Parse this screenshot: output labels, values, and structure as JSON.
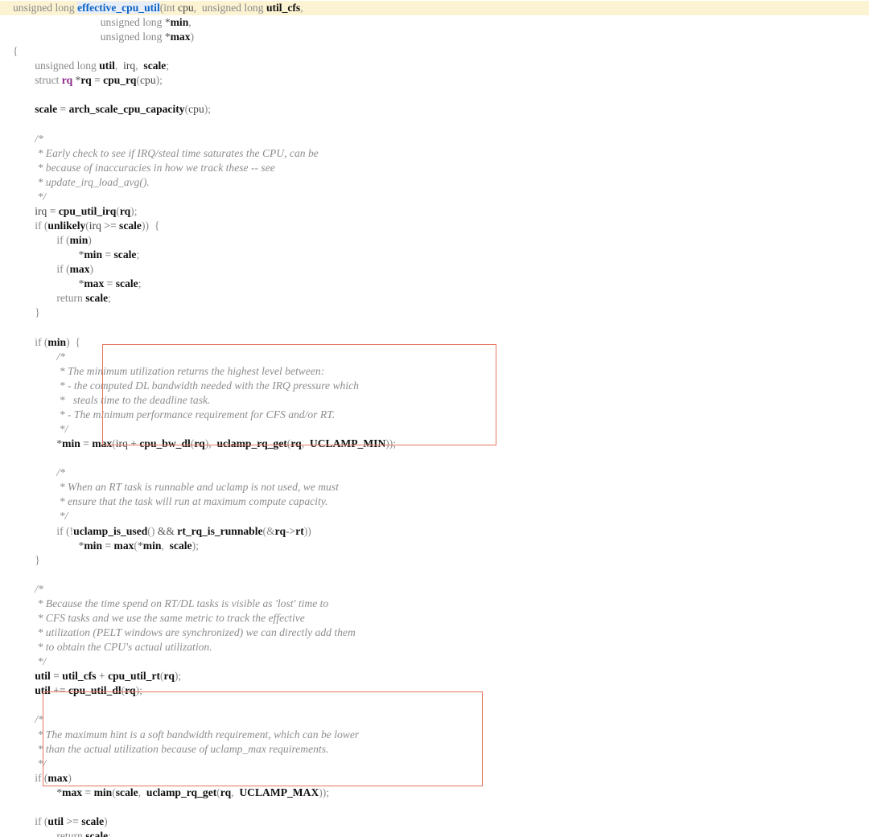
{
  "colors": {
    "current_line_bg": "#fcf3d3",
    "highlight_box": "#e4765f",
    "function_name": "#0c64c6",
    "keyword": "#888888",
    "comment": "#8d8d8d",
    "struct_keyword": "#8c2a8c"
  },
  "code": {
    "lines": [
      [
        [
          "kw",
          "unsigned long "
        ],
        [
          "fnsel",
          "effective_cpu_util"
        ],
        [
          "pn",
          "("
        ],
        [
          "kw",
          "int "
        ],
        [
          "id",
          "cpu"
        ],
        [
          "pn",
          ",  "
        ],
        [
          "kw",
          "unsigned long "
        ],
        [
          "var",
          "util_cfs"
        ],
        [
          "pn",
          ","
        ]
      ],
      [
        [
          "kw",
          "                                unsigned long "
        ],
        [
          "op",
          "*"
        ],
        [
          "var",
          "min"
        ],
        [
          "pn",
          ","
        ]
      ],
      [
        [
          "kw",
          "                                unsigned long "
        ],
        [
          "op",
          "*"
        ],
        [
          "var",
          "max"
        ],
        [
          "pn",
          ")"
        ]
      ],
      [
        [
          "pn",
          "{"
        ]
      ],
      [
        [
          "kw",
          "        unsigned long "
        ],
        [
          "var",
          "util"
        ],
        [
          "pn",
          ",  "
        ],
        [
          "id",
          "irq"
        ],
        [
          "pn",
          ",  "
        ],
        [
          "var",
          "scale"
        ],
        [
          "pn",
          ";"
        ]
      ],
      [
        [
          "kw",
          "        struct "
        ],
        [
          "ty",
          "rq "
        ],
        [
          "op",
          "*"
        ],
        [
          "var",
          "rq"
        ],
        [
          "op",
          " = "
        ],
        [
          "fn",
          "cpu_rq"
        ],
        [
          "pn",
          "("
        ],
        [
          "id",
          "cpu"
        ],
        [
          "pn",
          ");"
        ]
      ],
      [],
      [
        [
          "var",
          "        scale"
        ],
        [
          "op",
          " = "
        ],
        [
          "fn",
          "arch_scale_cpu_capacity"
        ],
        [
          "pn",
          "("
        ],
        [
          "id",
          "cpu"
        ],
        [
          "pn",
          ");"
        ]
      ],
      [],
      [
        [
          "cm",
          "        /*"
        ]
      ],
      [
        [
          "cm",
          "         * Early check to see if IRQ/steal time saturates the CPU, can be"
        ]
      ],
      [
        [
          "cm",
          "         * because of inaccuracies in how we track these -- see"
        ]
      ],
      [
        [
          "cm",
          "         * update_irq_load_avg()."
        ]
      ],
      [
        [
          "cm",
          "         */"
        ]
      ],
      [
        [
          "id",
          "        irq"
        ],
        [
          "op",
          " = "
        ],
        [
          "fn",
          "cpu_util_irq"
        ],
        [
          "pn",
          "("
        ],
        [
          "var",
          "rq"
        ],
        [
          "pn",
          ");"
        ]
      ],
      [
        [
          "kw",
          "        if "
        ],
        [
          "pn",
          "("
        ],
        [
          "fn",
          "unlikely"
        ],
        [
          "pn",
          "("
        ],
        [
          "id",
          "irq "
        ],
        [
          "op",
          ">= "
        ],
        [
          "var",
          "scale"
        ],
        [
          "pn",
          "))  {"
        ]
      ],
      [
        [
          "kw",
          "                if "
        ],
        [
          "pn",
          "("
        ],
        [
          "var",
          "min"
        ],
        [
          "pn",
          ")"
        ]
      ],
      [
        [
          "op",
          "                        *"
        ],
        [
          "var",
          "min"
        ],
        [
          "op",
          " = "
        ],
        [
          "var",
          "scale"
        ],
        [
          "pn",
          ";"
        ]
      ],
      [
        [
          "kw",
          "                if "
        ],
        [
          "pn",
          "("
        ],
        [
          "var",
          "max"
        ],
        [
          "pn",
          ")"
        ]
      ],
      [
        [
          "op",
          "                        *"
        ],
        [
          "var",
          "max"
        ],
        [
          "op",
          " = "
        ],
        [
          "var",
          "scale"
        ],
        [
          "pn",
          ";"
        ]
      ],
      [
        [
          "kw",
          "                return "
        ],
        [
          "var",
          "scale"
        ],
        [
          "pn",
          ";"
        ]
      ],
      [
        [
          "pn",
          "        }"
        ]
      ],
      [],
      [
        [
          "kw",
          "        if "
        ],
        [
          "pn",
          "("
        ],
        [
          "var",
          "min"
        ],
        [
          "pn",
          ")  {"
        ]
      ],
      [
        [
          "cm",
          "                /*"
        ]
      ],
      [
        [
          "cm",
          "                 * The minimum utilization returns the highest level between:"
        ]
      ],
      [
        [
          "cm",
          "                 * - the computed DL bandwidth needed with the IRQ pressure which"
        ]
      ],
      [
        [
          "cm",
          "                 *   steals time to the deadline task."
        ]
      ],
      [
        [
          "cm",
          "                 * - The minimum performance requirement for CFS and/or RT."
        ]
      ],
      [
        [
          "cm",
          "                 */"
        ]
      ],
      [
        [
          "op",
          "                *"
        ],
        [
          "var",
          "min"
        ],
        [
          "op",
          " = "
        ],
        [
          "fn",
          "max"
        ],
        [
          "pn",
          "("
        ],
        [
          "id",
          "irq "
        ],
        [
          "op",
          "+ "
        ],
        [
          "fn",
          "cpu_bw_dl"
        ],
        [
          "pn",
          "("
        ],
        [
          "var",
          "rq"
        ],
        [
          "pn",
          "),  "
        ],
        [
          "fn",
          "uclamp_rq_get"
        ],
        [
          "pn",
          "("
        ],
        [
          "var",
          "rq"
        ],
        [
          "pn",
          ",  "
        ],
        [
          "var",
          "UCLAMP_MIN"
        ],
        [
          "pn",
          "));"
        ]
      ],
      [],
      [
        [
          "cm",
          "                /*"
        ]
      ],
      [
        [
          "cm",
          "                 * When an RT task is runnable and uclamp is not used, we must"
        ]
      ],
      [
        [
          "cm",
          "                 * ensure that the task will run at maximum compute capacity."
        ]
      ],
      [
        [
          "cm",
          "                 */"
        ]
      ],
      [
        [
          "kw",
          "                if "
        ],
        [
          "pn",
          "(!"
        ],
        [
          "fn",
          "uclamp_is_used"
        ],
        [
          "pn",
          "() "
        ],
        [
          "op",
          "&& "
        ],
        [
          "fn",
          "rt_rq_is_runnable"
        ],
        [
          "pn",
          "(&"
        ],
        [
          "var",
          "rq"
        ],
        [
          "op",
          "->"
        ],
        [
          "var",
          "rt"
        ],
        [
          "pn",
          "))"
        ]
      ],
      [
        [
          "op",
          "                        *"
        ],
        [
          "var",
          "min"
        ],
        [
          "op",
          " = "
        ],
        [
          "fn",
          "max"
        ],
        [
          "pn",
          "("
        ],
        [
          "op",
          "*"
        ],
        [
          "var",
          "min"
        ],
        [
          "pn",
          ",  "
        ],
        [
          "var",
          "scale"
        ],
        [
          "pn",
          ");"
        ]
      ],
      [
        [
          "pn",
          "        }"
        ]
      ],
      [],
      [
        [
          "cm",
          "        /*"
        ]
      ],
      [
        [
          "cm",
          "         * Because the time spend on RT/DL tasks is visible as 'lost' time to"
        ]
      ],
      [
        [
          "cm",
          "         * CFS tasks and we use the same metric to track the effective"
        ]
      ],
      [
        [
          "cm",
          "         * utilization (PELT windows are synchronized) we can directly add them"
        ]
      ],
      [
        [
          "cm",
          "         * to obtain the CPU's actual utilization."
        ]
      ],
      [
        [
          "cm",
          "         */"
        ]
      ],
      [
        [
          "var",
          "        util"
        ],
        [
          "op",
          " = "
        ],
        [
          "var",
          "util_cfs"
        ],
        [
          "op",
          " + "
        ],
        [
          "fn",
          "cpu_util_rt"
        ],
        [
          "pn",
          "("
        ],
        [
          "var",
          "rq"
        ],
        [
          "pn",
          ");"
        ]
      ],
      [
        [
          "var",
          "        util"
        ],
        [
          "op",
          " += "
        ],
        [
          "fn",
          "cpu_util_dl"
        ],
        [
          "pn",
          "("
        ],
        [
          "var",
          "rq"
        ],
        [
          "pn",
          ");"
        ]
      ],
      [],
      [
        [
          "cm",
          "        /*"
        ]
      ],
      [
        [
          "cm",
          "         * The maximum hint is a soft bandwidth requirement, which can be lower"
        ]
      ],
      [
        [
          "cm",
          "         * than the actual utilization because of uclamp_max requirements."
        ]
      ],
      [
        [
          "cm",
          "         */"
        ]
      ],
      [
        [
          "kw",
          "        if "
        ],
        [
          "pn",
          "("
        ],
        [
          "var",
          "max"
        ],
        [
          "pn",
          ")"
        ]
      ],
      [
        [
          "op",
          "                *"
        ],
        [
          "var",
          "max"
        ],
        [
          "op",
          " = "
        ],
        [
          "fn",
          "min"
        ],
        [
          "pn",
          "("
        ],
        [
          "var",
          "scale"
        ],
        [
          "pn",
          ",  "
        ],
        [
          "fn",
          "uclamp_rq_get"
        ],
        [
          "pn",
          "("
        ],
        [
          "var",
          "rq"
        ],
        [
          "pn",
          ",  "
        ],
        [
          "var",
          "UCLAMP_MAX"
        ],
        [
          "pn",
          "));"
        ]
      ],
      [],
      [
        [
          "kw",
          "        if "
        ],
        [
          "pn",
          "("
        ],
        [
          "var",
          "util "
        ],
        [
          "op",
          ">= "
        ],
        [
          "var",
          "scale"
        ],
        [
          "pn",
          ")"
        ]
      ],
      [
        [
          "kw",
          "                return "
        ],
        [
          "var",
          "scale"
        ],
        [
          "pn",
          ";"
        ]
      ]
    ]
  }
}
